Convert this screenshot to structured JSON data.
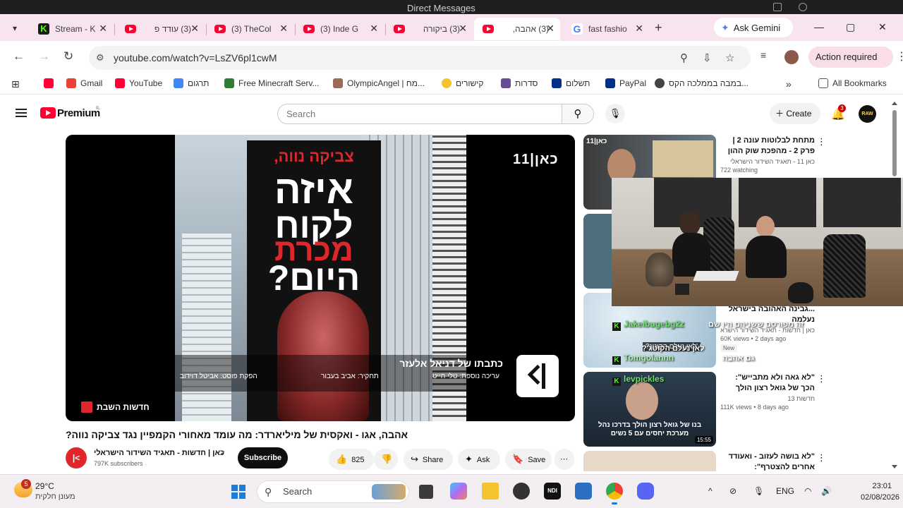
{
  "ghost_window": {
    "title": "Direct Messages"
  },
  "tabs": [
    {
      "label": "Stream - K",
      "favicon": "kick"
    },
    {
      "label": "(3) עודד פ",
      "favicon": "youtube"
    },
    {
      "label": "(3) TheCol",
      "favicon": "youtube"
    },
    {
      "label": "(3) Inde G",
      "favicon": "youtube"
    },
    {
      "label": "(3) ביקורה",
      "favicon": "youtube"
    },
    {
      "label": "(3) אהבה,",
      "favicon": "youtube",
      "active": true
    },
    {
      "label": "fast fashio",
      "favicon": "google"
    }
  ],
  "gemini": {
    "label": "Ask Gemini"
  },
  "toolbar": {
    "url": "youtube.com/watch?v=LsZV6pl1cwM",
    "action_required": "Action required"
  },
  "bookmarks": [
    {
      "label": "",
      "icon": "youtube"
    },
    {
      "label": "Gmail",
      "icon": "gmail"
    },
    {
      "label": "YouTube",
      "icon": "youtube"
    },
    {
      "label": "תרגום",
      "icon": "translate"
    },
    {
      "label": "Free Minecraft Serv...",
      "icon": "minecraft"
    },
    {
      "label": "OlympicAngel | מח...",
      "icon": "avatar"
    },
    {
      "label": "קישורים",
      "icon": "star"
    },
    {
      "label": "סדרות",
      "icon": "tv"
    },
    {
      "label": "תשלום",
      "icon": "paypal"
    },
    {
      "label": "PayPal",
      "icon": "paypal"
    },
    {
      "label": "במבה בממלכה הקס...",
      "icon": "globe"
    }
  ],
  "all_bookmarks": "All Bookmarks",
  "youtube": {
    "brand": "Premium",
    "country": "IL",
    "search_placeholder": "Search",
    "create": "Create",
    "notifications": "3",
    "avatar_text": "RAW"
  },
  "video": {
    "banner_line1": "צביקה נווה,",
    "banner_line2": "איזה",
    "banner_line3": "לקוח",
    "banner_line4": "מכרת",
    "banner_line5": "היום?",
    "channel_logo": "כאן|11",
    "credit_main": "כתבתו של דניאל אלעזר",
    "credit_editing": "עריכה נוספת: טלי חייט",
    "credit_research": "תחקיר: אביב בעבור",
    "credit_post": "הפקת פוסט: אביטל דוידוב",
    "news_tag": "חדשות השבת",
    "title": "אהבה, אגו - ואקסית של מיליארדר: מה עומד מאחורי הקמפיין נגד צביקה נווה?",
    "channel_name": "כאן | חדשות - תאגיד השידור הישראלי",
    "subscribers": "797K subscribers",
    "subscribe": "Subscribe",
    "likes": "825",
    "share": "Share",
    "ask": "Ask",
    "save": "Save"
  },
  "recommendations": [
    {
      "title": "מתחת לבלוטות עונה 2 | פרק 2 - מהפכת שוק ההון",
      "channel": "כאן 11 - תאגיד השידור הישראלי",
      "meta": "722 watching",
      "badge": ""
    },
    {
      "title": "...גבינה האהובה בישראל נעלמה",
      "channel": "כאן | חדשות - תאגיד השידור הישראלי",
      "meta": "60K views • 2 days ago",
      "badge": "New"
    },
    {
      "title": "\"לא גאה ולא מתבייש\": הכך של גואל רצון הולך בדרכו של אביו",
      "channel": "חדשות 13",
      "meta": "111K views • 8 days ago",
      "badge": "",
      "duration": "15:55",
      "thumb_text": "בנו של גואל רצון הולך בדרכו נהל מערכת יחסים עם 5 נשים"
    },
    {
      "title": "\"לא בושה לעזוב - ואעודד אחרים להצטרף\": הפטריוטים שנפרדו",
      "channel": "",
      "meta": "",
      "badge": ""
    }
  ],
  "chat_overlay": [
    {
      "user": "Jakeibugebg2z",
      "color": "#6fe36f",
      "text": ""
    },
    {
      "user": "",
      "color": "#ffffff",
      "text": "זה מפורסם ששניהם היו שם"
    },
    {
      "user": "",
      "color": "#ffffff",
      "text": "לאן נעלם הקוטג'?"
    },
    {
      "user": "Tomgolannn",
      "color": "#a8f0a8",
      "text": "גם אהבה"
    },
    {
      "user": "levpickles",
      "color": "#6fe36f",
      "text": ""
    }
  ],
  "taskbar": {
    "weather_badge": "5",
    "temperature": "29°C",
    "condition": "מעונן חלקית",
    "search": "Search",
    "language": "ENG",
    "time": "23:01",
    "date": "02/08/2026"
  }
}
